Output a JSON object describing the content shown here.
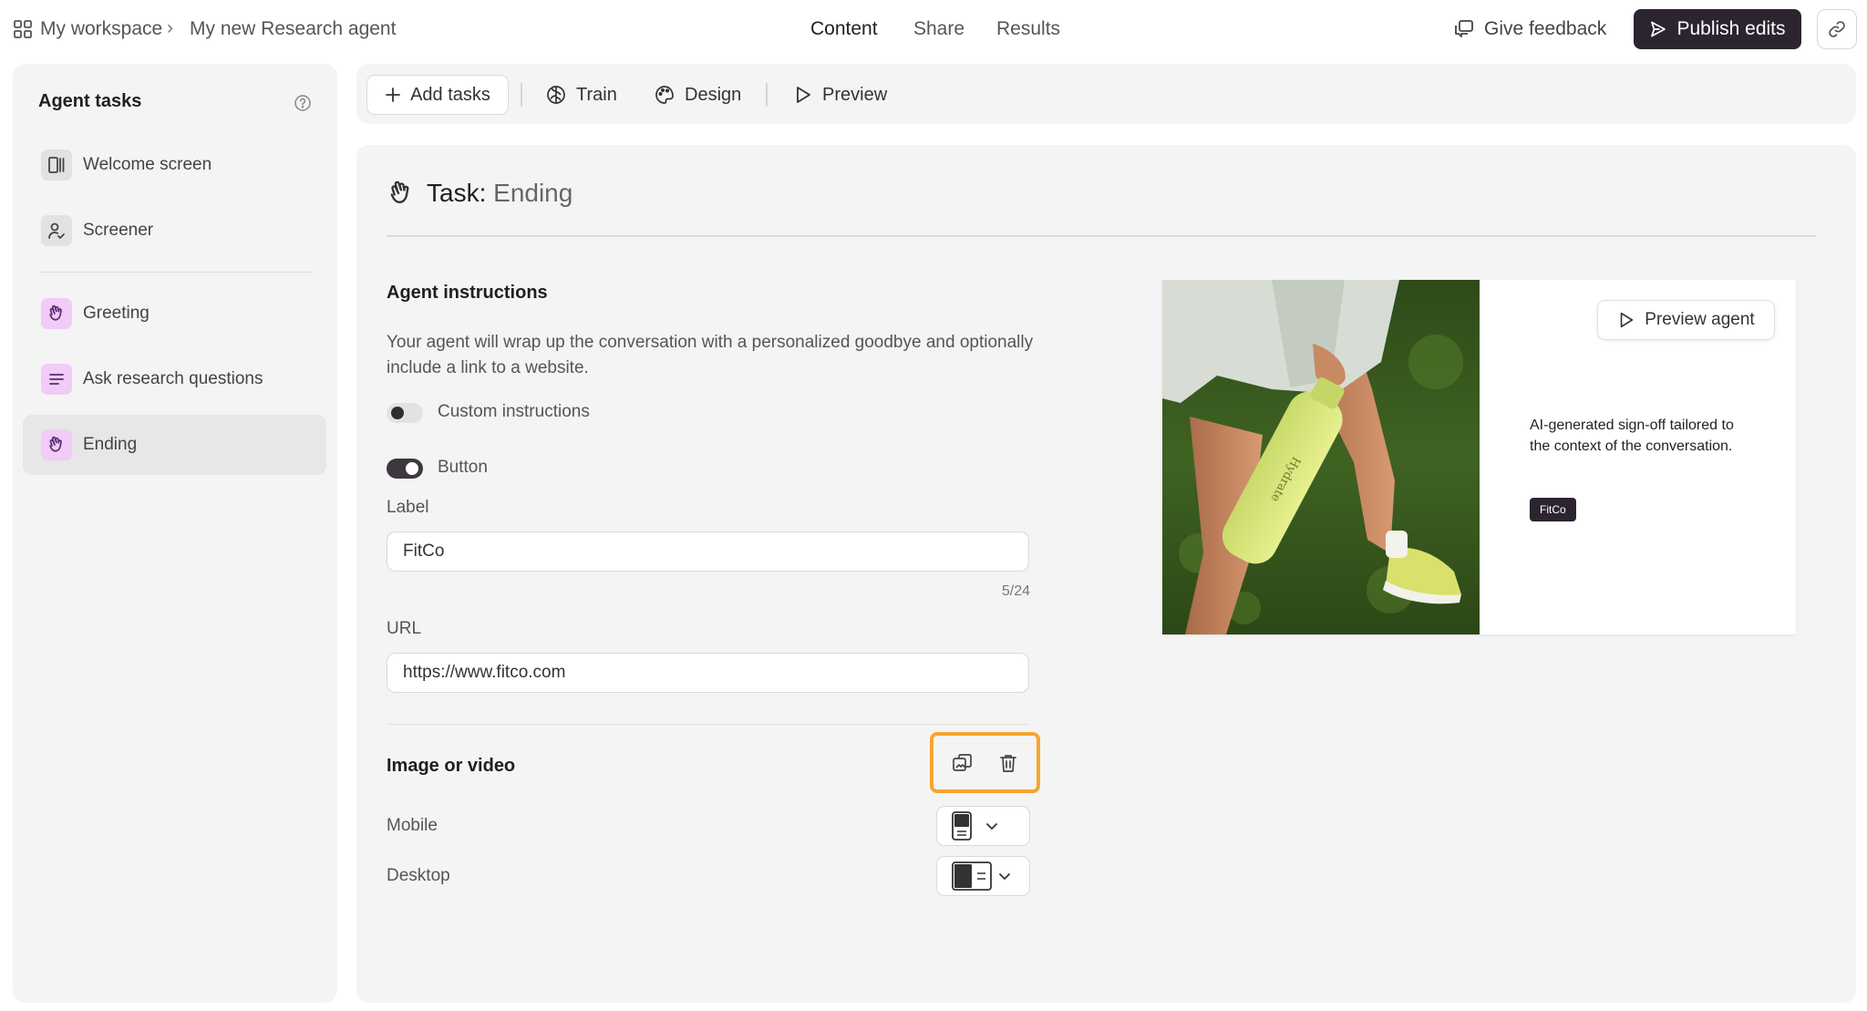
{
  "header": {
    "breadcrumb": {
      "workspace": "My workspace",
      "separator": "›",
      "agent": "My new Research agent"
    },
    "tabs": [
      {
        "label": "Content",
        "active": true
      },
      {
        "label": "Share",
        "active": false
      },
      {
        "label": "Results",
        "active": false
      }
    ],
    "feedback_label": "Give feedback",
    "publish_label": "Publish edits"
  },
  "sidebar": {
    "title": "Agent tasks",
    "items": [
      {
        "label": "Welcome screen",
        "icon": "welcome-screen-icon",
        "selected": false
      },
      {
        "label": "Screener",
        "icon": "screener-icon",
        "selected": false
      },
      {
        "label": "Greeting",
        "icon": "wave-hand-icon",
        "selected": false
      },
      {
        "label": "Ask research questions",
        "icon": "lines-icon",
        "selected": false
      },
      {
        "label": "Ending",
        "icon": "wave-hand-icon",
        "selected": true
      }
    ]
  },
  "toolbar": {
    "add_tasks": "Add tasks",
    "train": "Train",
    "design": "Design",
    "preview": "Preview"
  },
  "task": {
    "prefix": "Task:",
    "name": "Ending",
    "instructions_heading": "Agent instructions",
    "instructions_text": "Your agent will wrap up the conversation with a personalized goodbye and optionally include a link to a website.",
    "custom_instructions": {
      "label": "Custom instructions",
      "enabled": false
    },
    "button_toggle": {
      "label": "Button",
      "enabled": true
    },
    "label_field": {
      "label": "Label",
      "value": "FitCo",
      "counter": "5/24"
    },
    "url_field": {
      "label": "URL",
      "value": "https://www.fitco.com"
    },
    "media": {
      "heading": "Image or video",
      "mobile_label": "Mobile",
      "desktop_label": "Desktop"
    }
  },
  "preview": {
    "button_label": "Preview agent",
    "text": "AI-generated sign-off tailored to the context of the conversation.",
    "chip_label": "FitCo",
    "bottle_text": "Hydrate"
  },
  "colors": {
    "accent_dark": "#2c2530",
    "highlight_orange": "#f7a531",
    "task_icon_purple": "#f0ccf7",
    "panel_gray": "#f4f4f4"
  }
}
